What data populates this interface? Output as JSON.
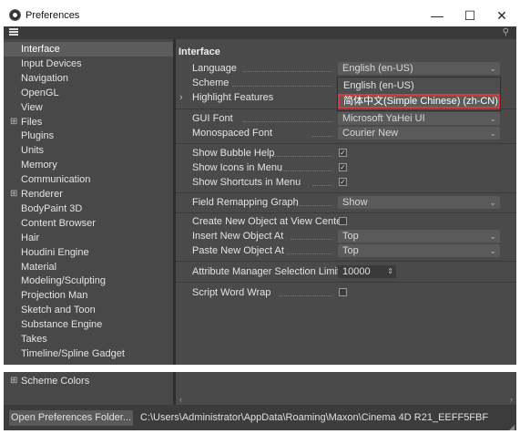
{
  "window": {
    "title": "Preferences",
    "minimize": "—",
    "maximize": "☐",
    "close": "✕"
  },
  "sidebar": {
    "items": [
      {
        "label": "Interface",
        "expandable": false,
        "selected": true
      },
      {
        "label": "Input Devices",
        "expandable": false
      },
      {
        "label": "Navigation",
        "expandable": false
      },
      {
        "label": "OpenGL",
        "expandable": false
      },
      {
        "label": "View",
        "expandable": false
      },
      {
        "label": "Files",
        "expandable": true
      },
      {
        "label": "Plugins",
        "expandable": false
      },
      {
        "label": "Units",
        "expandable": false
      },
      {
        "label": "Memory",
        "expandable": false
      },
      {
        "label": "Communication",
        "expandable": false
      },
      {
        "label": "Renderer",
        "expandable": true
      },
      {
        "label": "BodyPaint 3D",
        "expandable": false
      },
      {
        "label": "Content Browser",
        "expandable": false
      },
      {
        "label": "Hair",
        "expandable": false
      },
      {
        "label": "Houdini Engine",
        "expandable": false
      },
      {
        "label": "Material",
        "expandable": false
      },
      {
        "label": "Modeling/Sculpting",
        "expandable": false
      },
      {
        "label": "Projection Man",
        "expandable": false
      },
      {
        "label": "Sketch and Toon",
        "expandable": false
      },
      {
        "label": "Substance Engine",
        "expandable": false
      },
      {
        "label": "Takes",
        "expandable": false
      },
      {
        "label": "Timeline/Spline Gadget",
        "expandable": false
      }
    ],
    "lower_items": [
      {
        "label": "Scheme Colors",
        "expandable": true
      }
    ]
  },
  "interface": {
    "section_title": "Interface",
    "language_label": "Language",
    "language_value": "English (en-US)",
    "scheme_label": "Scheme",
    "highlight_label": "Highlight Features",
    "language_options": [
      "English (en-US)",
      "简体中文(Simple Chinese) (zh-CN)"
    ],
    "gui_font_label": "GUI Font",
    "gui_font_value": "Microsoft YaHei UI",
    "mono_font_label": "Monospaced Font",
    "mono_font_value": "Courier New",
    "bubble_help_label": "Show Bubble Help",
    "bubble_help_checked": true,
    "icons_menu_label": "Show Icons in Menu",
    "icons_menu_checked": true,
    "shortcuts_menu_label": "Show Shortcuts in Menu",
    "shortcuts_menu_checked": true,
    "field_remap_label": "Field Remapping Graph",
    "field_remap_value": "Show",
    "create_new_label": "Create New Object at View Center",
    "create_new_checked": false,
    "insert_new_label": "Insert New Object At",
    "insert_new_value": "Top",
    "paste_new_label": "Paste New Object At",
    "paste_new_value": "Top",
    "attr_limit_label": "Attribute Manager Selection Limit",
    "attr_limit_value": "10000",
    "script_wrap_label": "Script Word Wrap",
    "script_wrap_checked": false
  },
  "footer": {
    "open_folder_label": "Open Preferences Folder...",
    "path": "C:\\Users\\Administrator\\AppData\\Roaming\\Maxon\\Cinema 4D R21_EEFF5FBF"
  },
  "colors": {
    "panel_bg": "#4a4a4a",
    "sidebar_bg": "#484848",
    "highlight_outline": "#d93a3a"
  }
}
